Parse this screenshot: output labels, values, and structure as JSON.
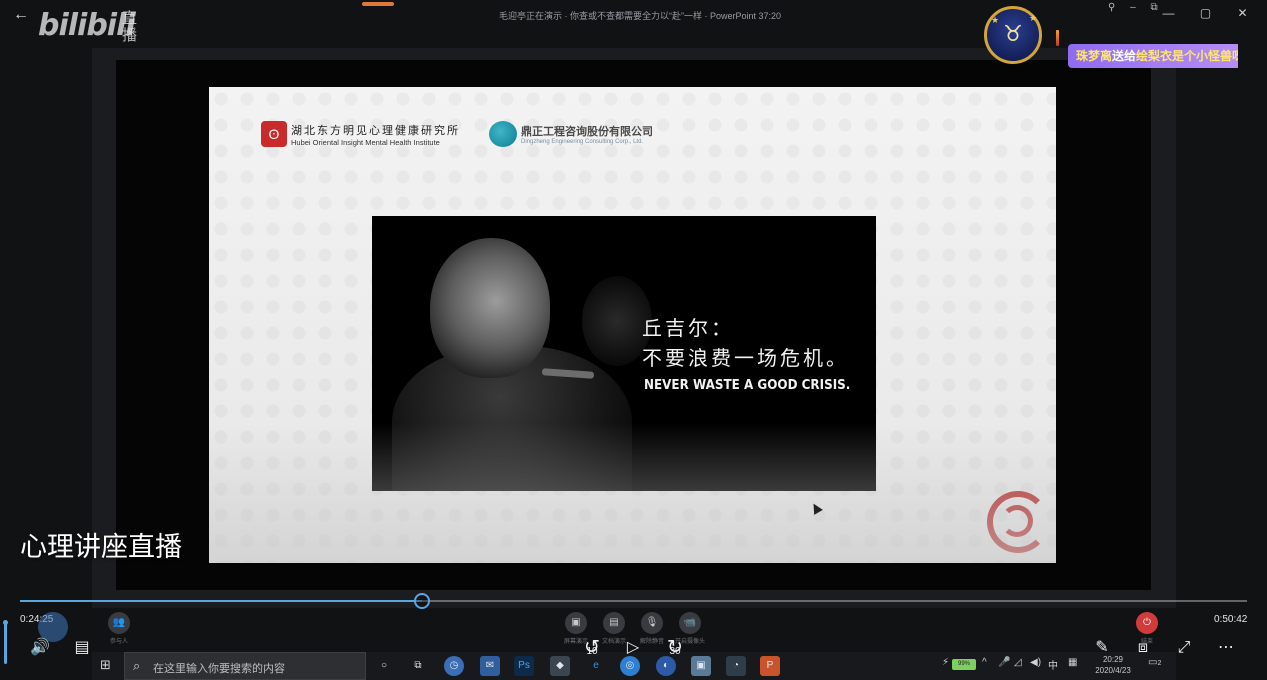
{
  "header": {
    "back_label": "←",
    "brand": "bilibili",
    "brand_live": "直播",
    "meeting_status": "毛迎亭正在演示 · 你查或不查都需要全力以“赴”一样 · PowerPoint 37:20",
    "window_controls": [
      "—",
      "▢",
      "✕"
    ],
    "pin_controls": "⚲ – ⧉"
  },
  "avatar": {
    "glyph": "♉"
  },
  "gift_banner": {
    "sender": "珠梦离",
    "verb": "送给",
    "receiver": "绘梨衣是个小怪兽呀"
  },
  "slide": {
    "org1_name_cn": "湖北东方明见心理健康研究所",
    "org1_name_en": "Hubei Oriental Insight Mental Health Institute",
    "org2_name_cn": "鼎正工程咨询股份有限公司",
    "org2_name_en": "Dingzheng Engineering Consulting Corp., Ltd.",
    "quote_author": "丘吉尔：",
    "quote_cn": "不要浪费一场危机。",
    "quote_en": "NEVER WASTE A GOOD CRISIS."
  },
  "stream_title": "心理讲座直播",
  "player": {
    "current_time": "0:24:25",
    "total_time": "0:50:42",
    "progress": 0.328,
    "rewind_label": "10",
    "forward_label": "30"
  },
  "meeting_tools": [
    {
      "icon": "participants-icon",
      "glyph": "👥",
      "label": "参与人"
    },
    {
      "icon": "share-screen-icon",
      "glyph": "▣",
      "label": "屏幕演示"
    },
    {
      "icon": "file-share-icon",
      "glyph": "▤",
      "label": "文档演示"
    },
    {
      "icon": "mic-icon",
      "glyph": "🎙",
      "label": "解除静音"
    },
    {
      "icon": "camera-icon",
      "glyph": "📹",
      "label": "开启摄像头"
    },
    {
      "icon": "end-icon",
      "glyph": "⏻",
      "label": "结束"
    }
  ],
  "taskbar": {
    "search_placeholder": "在这里输入你要搜索的内容",
    "clock_time": "20:29",
    "clock_date": "2020/4/23",
    "battery": "99%",
    "ime": "中",
    "notification_count": "2"
  },
  "colors": {
    "accent": "#5aa6e0",
    "end_red": "#d23b3b",
    "banner": "#9a77f0"
  }
}
